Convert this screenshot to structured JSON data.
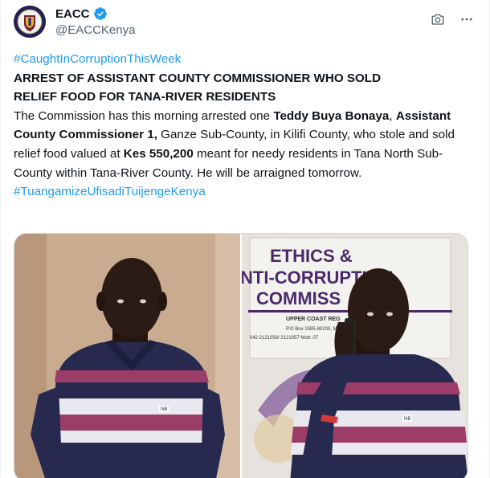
{
  "account": {
    "display_name": "EACC",
    "handle": "@EACCKenya",
    "avatar_icon": "eacc-logo-icon",
    "verified_icon": "verified-badge-icon"
  },
  "toolbar": {
    "camera_icon": "camera-icon",
    "more_icon": "more-options-icon"
  },
  "tweet": {
    "hashtag_top": "#CaughtInCorruptionThisWeek",
    "headline_line1": "ARREST OF  ASSISTANT COUNTY COMMISSIONER WHO SOLD",
    "headline_line2": "RELIEF FOOD FOR TANA-RIVER RESIDENTS",
    "segments": {
      "s1": "The Commission has this morning arrested one ",
      "s2": "Teddy Buya Bonaya",
      "s3": ", ",
      "s4": "Assistant County Commissioner 1,",
      "s5": "  Ganze Sub-County, in Kilifi County, who stole and sold relief food valued at ",
      "s6": "Kes 550,200",
      "s7": " meant for needy residents in Tana North Sub-County within Tana-River County. He will be arraigned tomorrow."
    },
    "hashtag_bottom": "#TuangamizeUfisadiTuijengeKenya"
  },
  "media": {
    "photo2_sign": {
      "line1": "ETHICS &",
      "line2": "NTI-CORRUPTION",
      "line3": "COMMISS",
      "line4": "UPPER COAST REG",
      "line5": "P.O Box 1595-80200, M",
      "line6": "042 2121056/ 2121057 Mob: 07"
    },
    "shirt_label": "NB",
    "colors": {
      "wall_left": "#c7a98f",
      "wall_right": "#e6e3df",
      "shirt_navy": "#27294f",
      "shirt_stripe_white": "#e9e8ee",
      "shirt_stripe_pink": "#9b3d68",
      "skin": "#2a1b14",
      "sign_purple": "#4b2a6b"
    }
  }
}
